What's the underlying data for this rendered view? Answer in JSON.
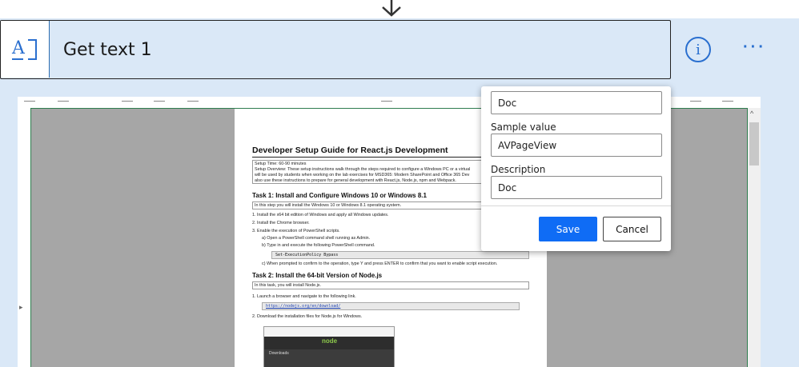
{
  "action": {
    "title": "Get text 1",
    "icon": "text-recognition-icon",
    "icon_glyph": "A",
    "info_glyph": "i",
    "more_glyph": "···"
  },
  "preview": {
    "document": {
      "title": "Developer Setup Guide for React.js Development",
      "setup_time": "Setup Time: 60-90 minutes",
      "overview_1": "Setup Overview: These setup instructions walk through the steps required to configure a Windows PC or a virtual",
      "overview_2": "will be used by students when working on the lab exercises for MSD365: Modern SharePoint and Office 365 Dev",
      "overview_3": "also use these instructions to prepare for general development with React.js, Node.js, npm and Webpack.",
      "task1_title": "Task 1: Install and Configure Windows 10 or Windows 8.1",
      "task1_intro": "In this step you will install the Windows 10 or Windows 8.1 operating system.",
      "task1_steps": [
        "1.   Install the x64 bit edition of Windows and apply all Windows updates.",
        "2.   Install the Chrome browser.",
        "3.   Enable the execution of PowerShell scripts.",
        "a)   Open a PowerShell command shell running as Admin.",
        "b)   Type in and execute the following PowerShell command."
      ],
      "task1_code": "Set-ExecutionPolicy Bypass",
      "task1_step_c": "c)   When prompted to confirm to the operation, type Y and press ENTER to confirm that you want to enable script execution.",
      "task2_title": "Task 2: Install the 64-bit Version of Node.js",
      "task2_intro": "In this task, you will install Node.js.",
      "task2_step1": "1.   Launch a browser and navigate to the following link.",
      "task2_link": "https://nodejs.org/en/download/",
      "task2_step2": "2.   Download the installation files for Node.js for Windows.",
      "image_brand": "node",
      "image_heading": "Downloads"
    },
    "scroll_up_glyph": "^",
    "left_arrow_glyph": "▸"
  },
  "popup": {
    "first_field_value": "Doc",
    "sample_value_label": "Sample value",
    "sample_value": "AVPageView",
    "description_label": "Description",
    "description_value": "Doc",
    "save_label": "Save",
    "cancel_label": "Cancel"
  },
  "colors": {
    "accent": "#0f6cf5",
    "header_bg": "#dae8f7",
    "icon_blue": "#2a6fcf"
  }
}
